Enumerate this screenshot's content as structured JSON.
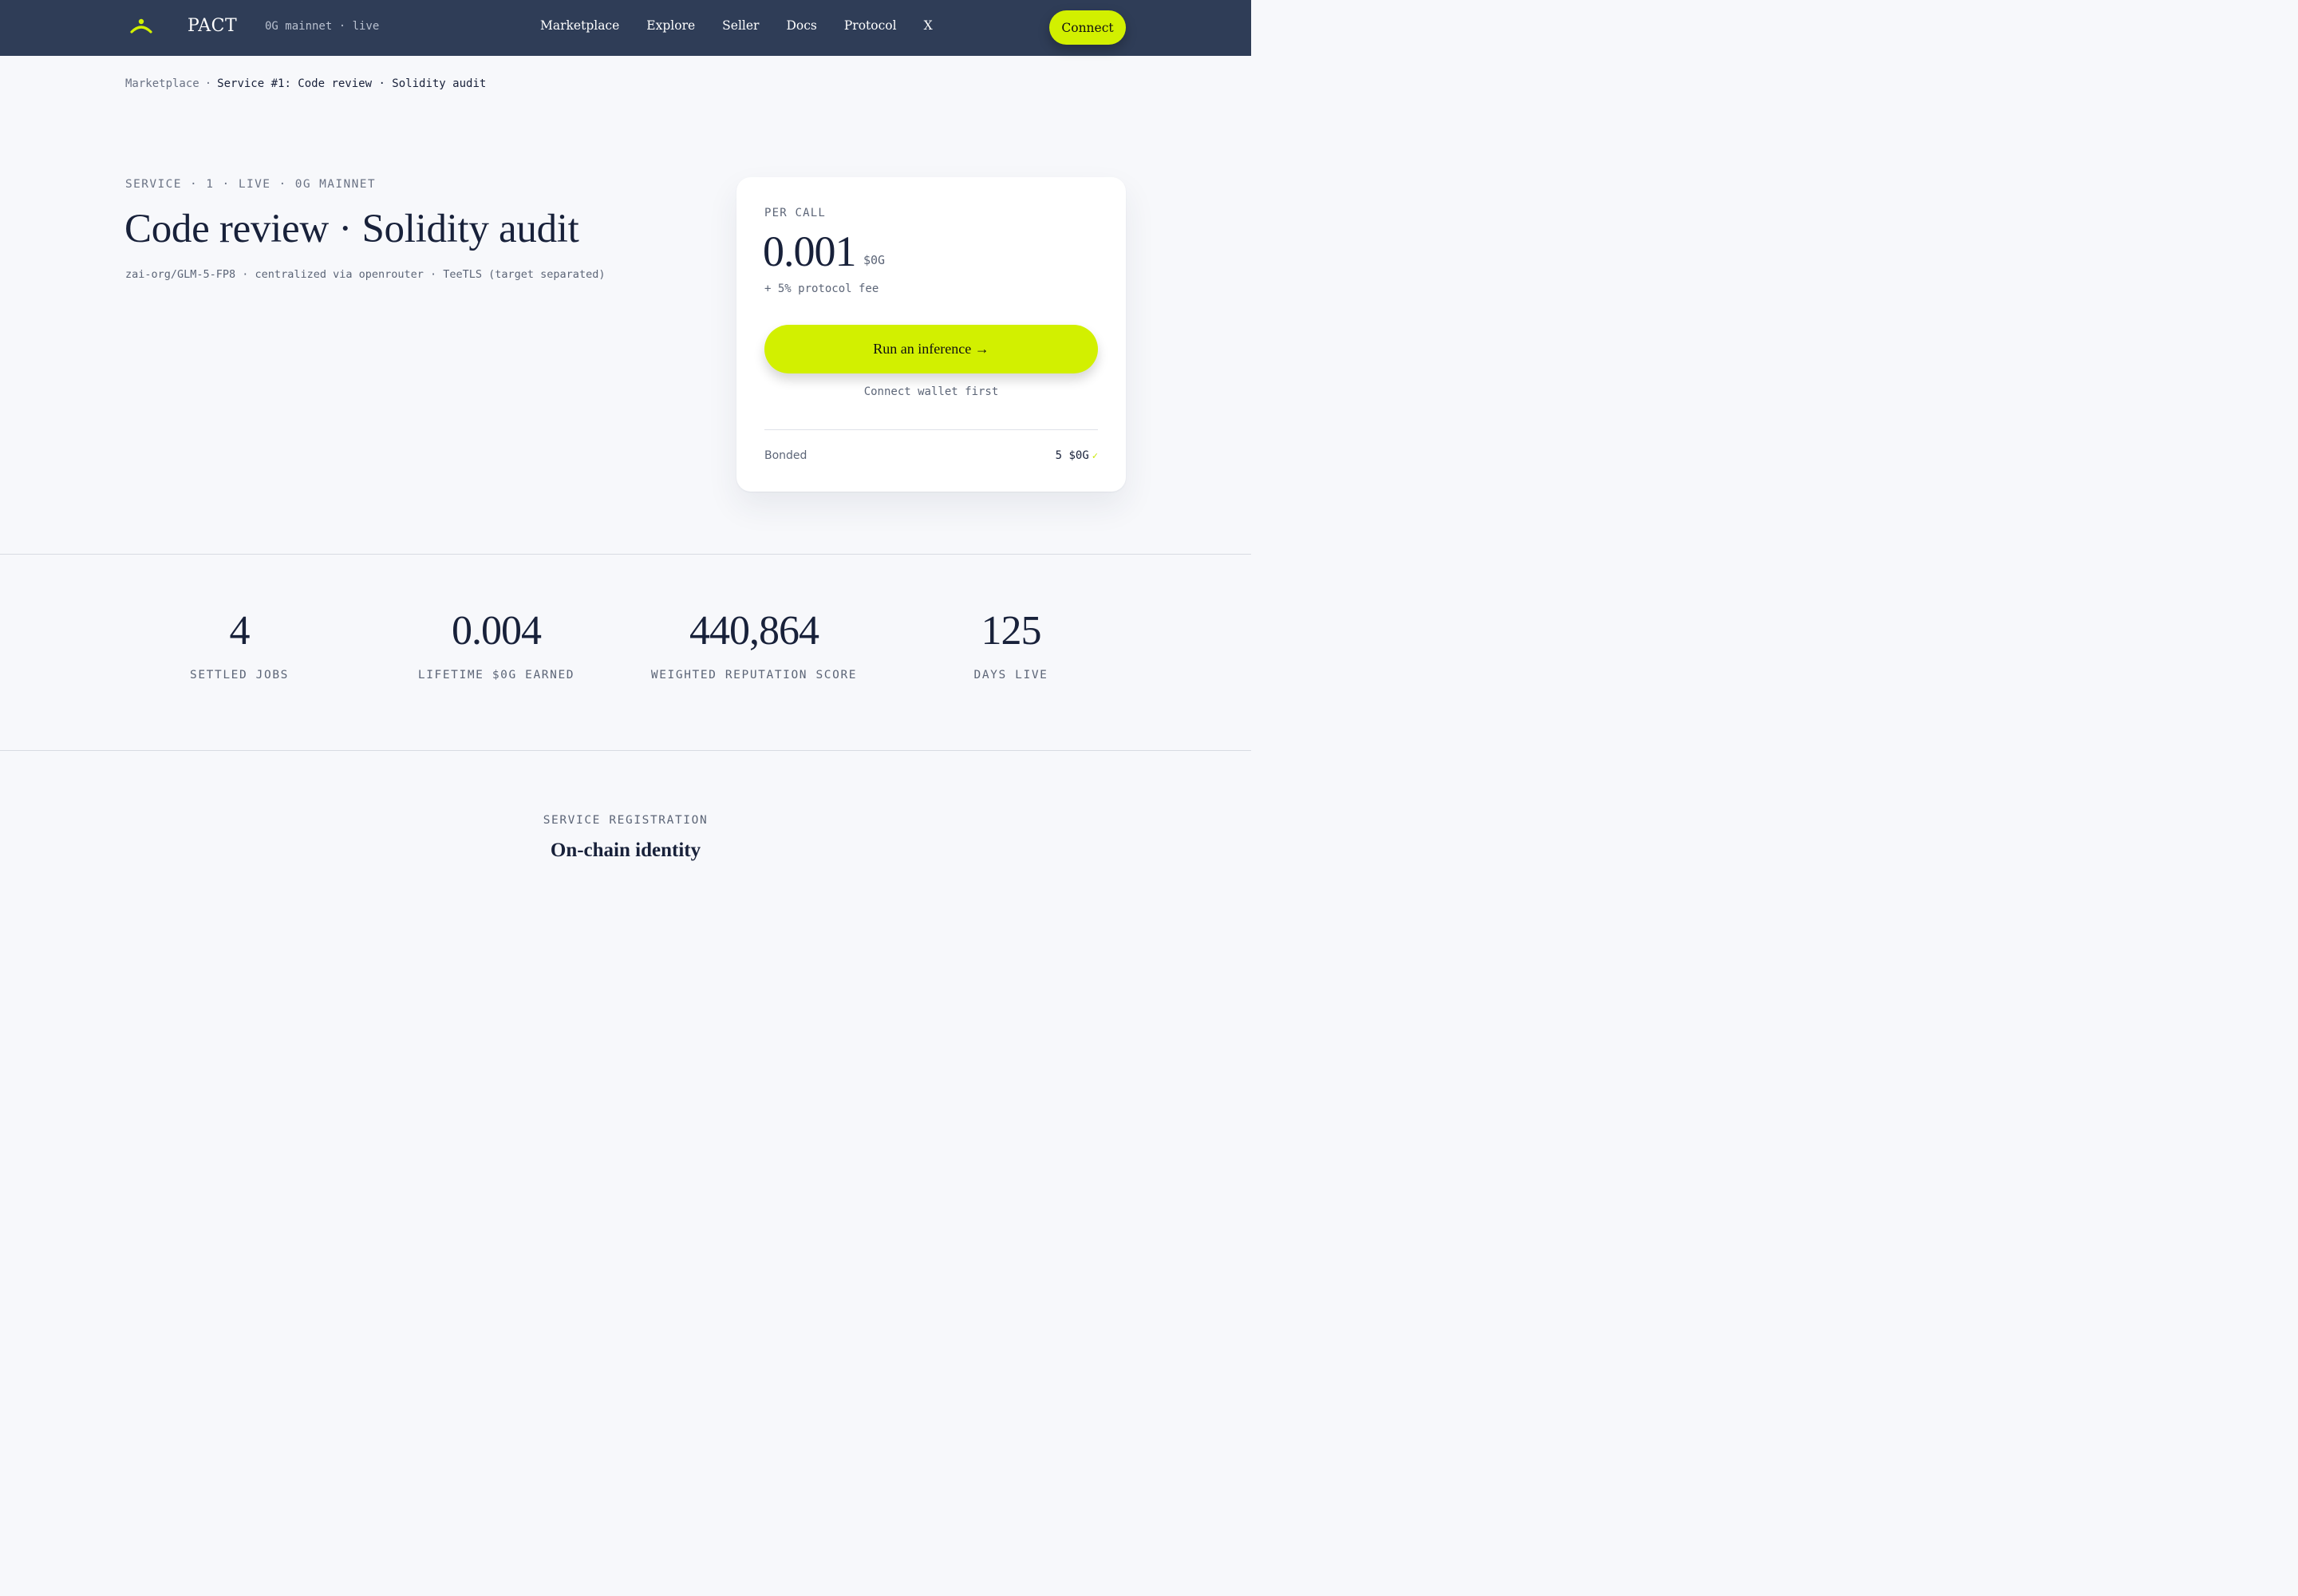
{
  "header": {
    "brand": "PACT",
    "network_status": "0G mainnet · live",
    "nav": [
      "Marketplace",
      "Explore",
      "Seller",
      "Docs",
      "Protocol",
      "X"
    ],
    "connect_label": "Connect",
    "accent_color": "#d2f000",
    "background_color": "#2f3d57",
    "logo_icon": "pact-logo-icon"
  },
  "breadcrumb": {
    "root": "Marketplace",
    "separator": "·",
    "current": "Service #1: Code review · Solidity audit"
  },
  "service": {
    "kicker": "SERVICE · 1 · LIVE · 0G MAINNET",
    "title": "Code review · Solidity audit",
    "model_info": "zai-org/GLM-5-FP8 · centralized via openrouter · TeeTLS (target separated)"
  },
  "pricing": {
    "label": "PER CALL",
    "price": "0.001",
    "unit": "$0G",
    "fee_note": "+ 5% protocol fee",
    "run_label": "Run an inference →",
    "hint": "Connect wallet first",
    "bonded_label": "Bonded",
    "bonded_value": "5 $0G",
    "bonded_check": "✓"
  },
  "stats": [
    {
      "value": "4",
      "label": "SETTLED JOBS"
    },
    {
      "value": "0.004",
      "label": "LIFETIME $0G EARNED"
    },
    {
      "value": "440,864",
      "label": "WEIGHTED REPUTATION SCORE"
    },
    {
      "value": "125",
      "label": "DAYS LIVE"
    }
  ],
  "registration": {
    "kicker": "SERVICE REGISTRATION",
    "title": "On-chain identity"
  }
}
